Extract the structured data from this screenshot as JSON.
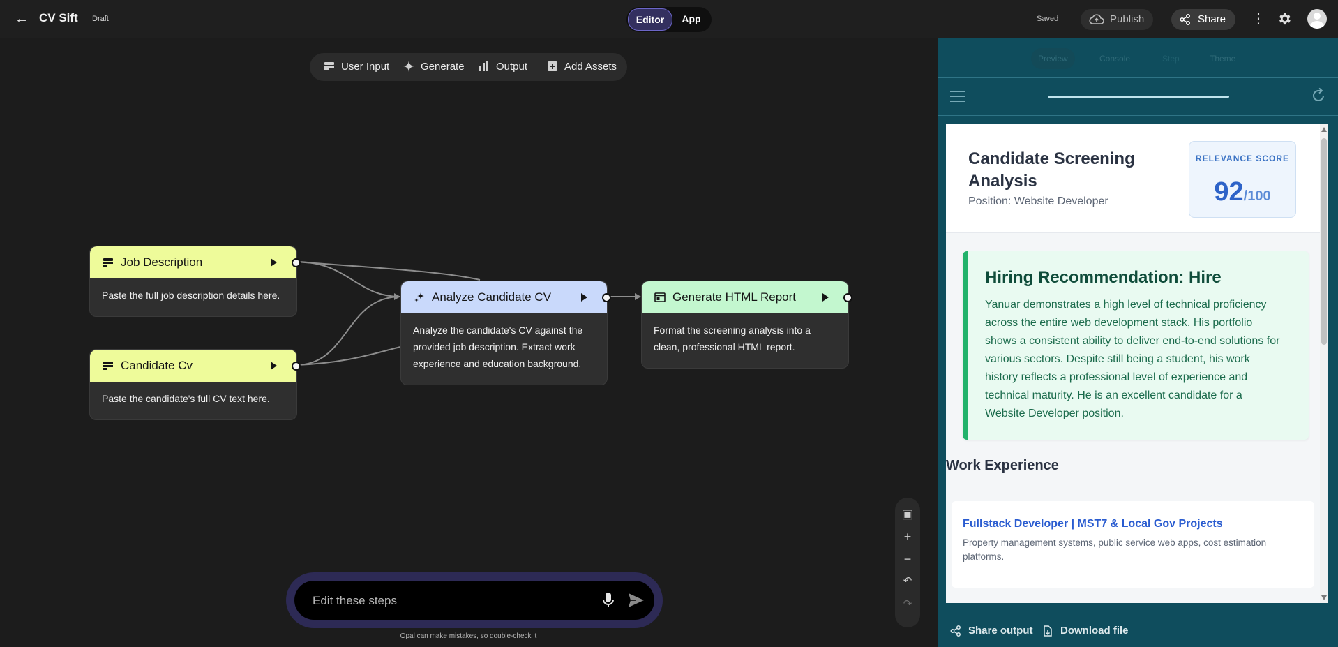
{
  "header": {
    "back_icon": "arrow-left-icon",
    "title": "CV Sift",
    "status": "Draft",
    "modes": [
      "Editor",
      "App"
    ],
    "active_mode": "Editor",
    "save_state": "Saved",
    "publish_label": "Publish",
    "share_label": "Share"
  },
  "toolbar": {
    "items": [
      {
        "label": "User Input",
        "icon": "user-input-icon"
      },
      {
        "label": "Generate",
        "icon": "sparkle-icon"
      },
      {
        "label": "Output",
        "icon": "output-icon"
      },
      {
        "label": "Add Assets",
        "icon": "add-assets-icon"
      }
    ]
  },
  "nodes": [
    {
      "id": "job_description",
      "title": "Job Description",
      "type": "user-input",
      "color": "#eefb9a",
      "body": "Paste the full job description details here."
    },
    {
      "id": "candidate_cv",
      "title": "Candidate Cv",
      "type": "user-input",
      "color": "#eefb9a",
      "body": "Paste the candidate's full CV text here."
    },
    {
      "id": "analyze_cv",
      "title": "Analyze Candidate CV",
      "type": "generate",
      "color": "#c9d9fb",
      "body": "Analyze the candidate's CV against the provided job description. Extract work experience and education background."
    },
    {
      "id": "html_report",
      "title": "Generate HTML Report",
      "type": "output",
      "color": "#c3f7cf",
      "body": "Format the screening analysis into a clean, professional HTML report."
    }
  ],
  "prompt": {
    "placeholder": "Edit these steps",
    "disclaimer": "Opal can make mistakes, so double-check it"
  },
  "panel": {
    "tabs": [
      "Preview",
      "Console",
      "Step",
      "Theme"
    ],
    "active_tab": "Preview",
    "progress": 1.0,
    "report": {
      "title": "Candidate Screening Analysis",
      "position": "Position: Website Developer",
      "score_label": "RELEVANCE SCORE",
      "score": "92",
      "score_max": "/100",
      "recommendation_title": "Hiring Recommendation: Hire",
      "recommendation_text": "Yanuar demonstrates a high level of technical proficiency across the entire web development stack. His portfolio shows a consistent ability to deliver end-to-end solutions for various sectors. Despite still being a student, his work history reflects a professional level of experience and technical maturity. He is an excellent candidate for a Website Developer position.",
      "work_experience_heading": "Work Experience",
      "jobs": [
        {
          "title": "Fullstack Developer | MST7 & Local Gov Projects",
          "description": "Property management systems, public service web apps, cost estimation platforms."
        }
      ]
    },
    "share_output_label": "Share output",
    "download_label": "Download file"
  },
  "colors": {
    "accent": "#6c66c7",
    "panel_bg": "#0f4d5d",
    "hire_green": "#22b26b",
    "score_blue": "#2e63c8"
  }
}
